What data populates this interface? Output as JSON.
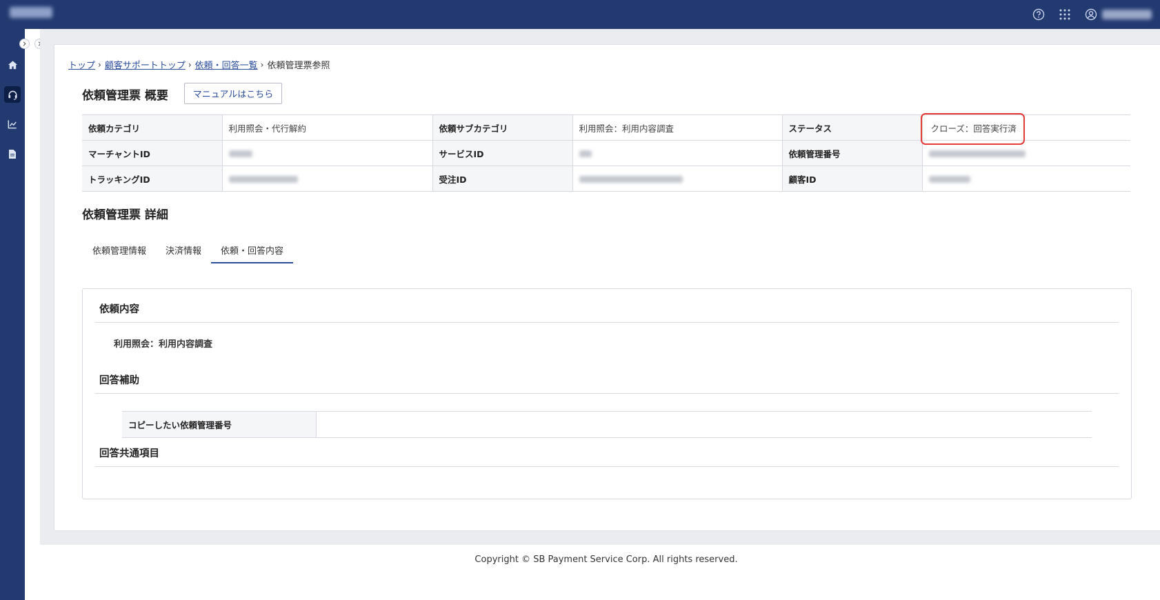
{
  "header": {
    "icons": [
      "help-circle-icon",
      "apps-grid-icon",
      "user-icon"
    ]
  },
  "sidebar": {
    "icons": [
      "home-icon",
      "headset-icon",
      "chart-icon",
      "document-icon"
    ]
  },
  "breadcrumb": {
    "items": [
      "トップ",
      "顧客サポートトップ",
      "依頼・回答一覧"
    ],
    "current": "依頼管理票参照",
    "separator": "›"
  },
  "overview": {
    "title": "依頼管理票 概要",
    "manual_button": "マニュアルはこちら",
    "rows": [
      {
        "l1": "依頼カテゴリ",
        "v1": "利用照会・代行解約",
        "l2": "依頼サブカテゴリ",
        "v2": "利用照会：利用内容調査",
        "l3": "ステータス",
        "v3": "クローズ：回答実行済"
      },
      {
        "l1": "マーチャントID",
        "v1": "",
        "l2": "サービスID",
        "v2": "",
        "l3": "依頼管理番号",
        "v3": ""
      },
      {
        "l1": "トラッキングID",
        "v1": "",
        "l2": "受注ID",
        "v2": "",
        "l3": "顧客ID",
        "v3": ""
      }
    ]
  },
  "details": {
    "title": "依頼管理票 詳細",
    "tabs": [
      "依頼管理情報",
      "決済情報",
      "依頼・回答内容"
    ],
    "active_tab": 2,
    "request_section": {
      "title": "依頼内容",
      "text": "利用照会：利用内容調査"
    },
    "assist_section": {
      "title": "回答補助",
      "copy_label": "コピーしたい依頼管理番号",
      "copy_value": ""
    },
    "common_section": {
      "title": "回答共通項目"
    }
  },
  "footer": {
    "copyright": "Copyright © SB Payment Service Corp. All rights reserved."
  },
  "colors": {
    "header_bg": "#233a71",
    "accent": "#2b4c9b",
    "highlight": "#e53935"
  }
}
